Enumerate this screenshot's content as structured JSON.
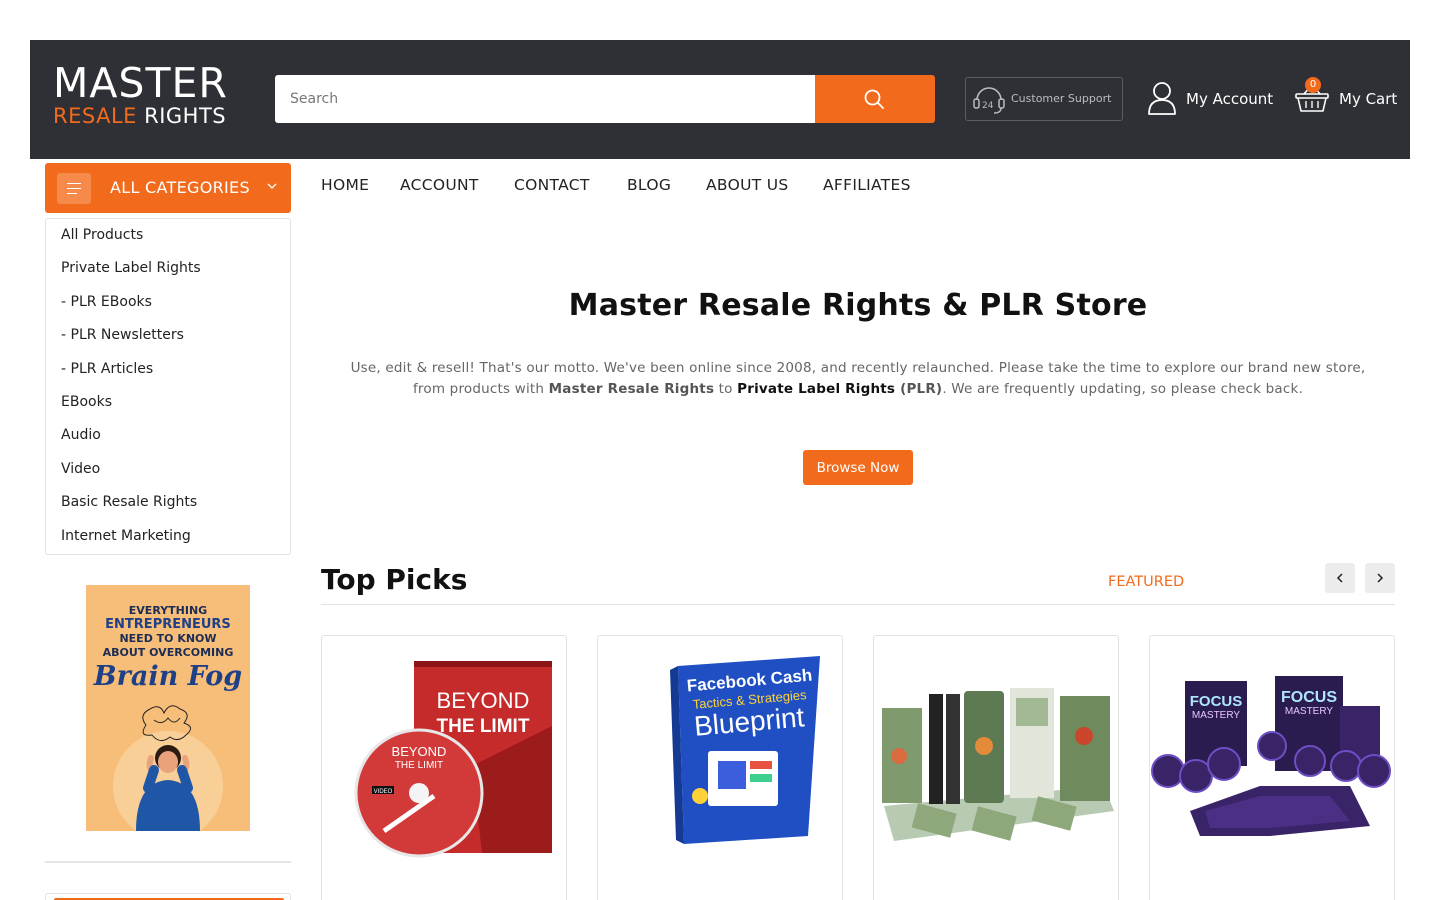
{
  "header": {
    "logo": {
      "line1": "MASTER",
      "line2a": "RESALE",
      "line2b": "RIGHTS"
    },
    "search": {
      "placeholder": "Search",
      "value": ""
    },
    "support_label": "Customer Support",
    "account_label": "My Account",
    "cart_label": "My Cart",
    "cart_count": "0"
  },
  "categories": {
    "button_label": "ALL CATEGORIES",
    "items": [
      {
        "label": "All Products"
      },
      {
        "label": "Private Label Rights"
      },
      {
        "label": "- PLR EBooks"
      },
      {
        "label": "- PLR Newsletters"
      },
      {
        "label": "- PLR Articles"
      },
      {
        "label": "EBooks"
      },
      {
        "label": "Audio"
      },
      {
        "label": "Video"
      },
      {
        "label": "Basic Resale Rights"
      },
      {
        "label": "Internet Marketing"
      }
    ]
  },
  "promo": {
    "line1": "EVERYTHING",
    "line2": "ENTREPRENEURS",
    "line3": "NEED TO KNOW",
    "line4": "ABOUT OVERCOMING",
    "script": "Brain Fog"
  },
  "nav": [
    {
      "label": "HOME"
    },
    {
      "label": "ACCOUNT"
    },
    {
      "label": "CONTACT"
    },
    {
      "label": "BLOG"
    },
    {
      "label": "ABOUT US"
    },
    {
      "label": "AFFILIATES"
    }
  ],
  "hero": {
    "title": "Master Resale Rights & PLR Store",
    "text_part1": "Use, edit & resell! That's our motto. We've been online since 2008, and recently relaunched. Please take the time to explore our brand new store, from products with ",
    "bold1": "Master Resale Rights",
    "text_part2": " to ",
    "bold2": "Private Label Rights",
    "bold3": " (PLR)",
    "text_part3": ". We are frequently updating, so please check back.",
    "button_label": "Browse Now"
  },
  "top_picks": {
    "title": "Top Picks",
    "tab_label": "FEATURED",
    "products": [
      {
        "cover_line1": "BEYOND",
        "cover_line2": "THE LIMIT",
        "disc_line1": "BEYOND",
        "disc_line2": "THE LIMIT",
        "disc_badge": "VIDEO"
      },
      {
        "cover_line1": "Facebook Cash",
        "cover_line2": "Tactics & Strategies",
        "cover_line3": "Blueprint"
      },
      {
        "cover_text": ""
      },
      {
        "cover_line1": "FOCUS",
        "cover_line2": "MASTERY"
      }
    ]
  },
  "colors": {
    "accent": "#f26b1d",
    "header_bg": "#2e3035"
  },
  "icons": [
    "search-icon",
    "headset-24-icon",
    "user-icon",
    "basket-icon",
    "hamburger-icon",
    "chevron-down-icon",
    "chevron-left-icon",
    "chevron-right-icon"
  ]
}
